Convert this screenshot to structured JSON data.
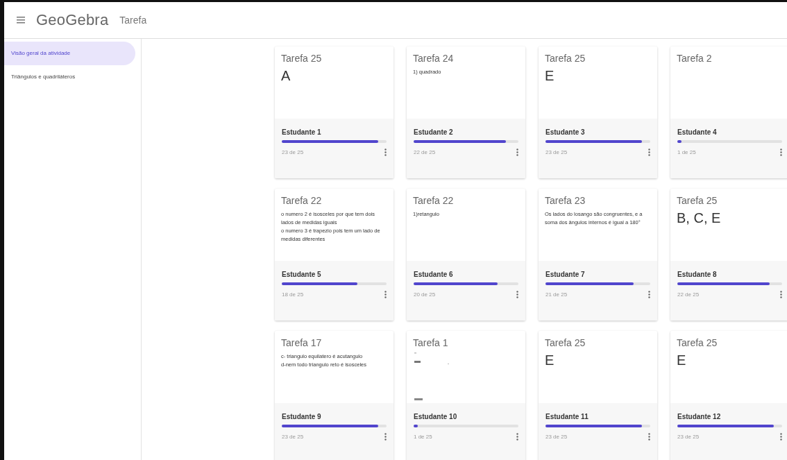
{
  "header": {
    "logo": "GeoGebra",
    "title": "Tarefa"
  },
  "sidebar": {
    "items": [
      {
        "label": "Visão geral da atividade",
        "selected": true
      },
      {
        "label": "Triângulos e quadriláteros",
        "selected": false
      }
    ]
  },
  "cards": [
    {
      "task": "Tarefa 25",
      "answer": {
        "kind": "letter",
        "lines": [
          "A"
        ]
      },
      "student": "Estudante 1",
      "level": 0.92,
      "progress": "23 de 25"
    },
    {
      "task": "Tarefa 24",
      "answer": {
        "kind": "text",
        "lines": [
          "1) quadrado"
        ]
      },
      "student": "Estudante 2",
      "level": 0.88,
      "progress": "22 de 25"
    },
    {
      "task": "Tarefa 25",
      "answer": {
        "kind": "letter",
        "lines": [
          "E"
        ]
      },
      "student": "Estudante 3",
      "level": 0.92,
      "progress": "23 de 25"
    },
    {
      "task": "Tarefa 2",
      "answer": {
        "kind": "none"
      },
      "student": "Estudante 4",
      "level": 0.04,
      "progress": "1 de 25"
    },
    {
      "task": "Tarefa 22",
      "answer": {
        "kind": "text",
        "lines": [
          "o numero 2 é isosceles por que tem dois lados de medidas iguais",
          "o numero 3 é trapezio pois tem um lado de medidas diferentes"
        ]
      },
      "student": "Estudante 5",
      "level": 0.72,
      "progress": "18 de 25"
    },
    {
      "task": "Tarefa 22",
      "answer": {
        "kind": "text",
        "lines": [
          "1)retangulo"
        ]
      },
      "student": "Estudante 6",
      "level": 0.8,
      "progress": "20 de 25"
    },
    {
      "task": "Tarefa 23",
      "answer": {
        "kind": "text",
        "lines": [
          "Os lados do losango são congruentes, e a soma dos ângulos internos é igual a 180°"
        ]
      },
      "student": "Estudante 7",
      "level": 0.84,
      "progress": "21 de 25"
    },
    {
      "task": "Tarefa 25",
      "answer": {
        "kind": "letter",
        "lines": [
          "B, C, E"
        ]
      },
      "student": "Estudante 8",
      "level": 0.88,
      "progress": "22 de 25"
    },
    {
      "task": "Tarefa 17",
      "answer": {
        "kind": "text",
        "lines": [
          "c- triangulo equilatero é acutangulo",
          "d-nem todo triangulo reto é isosceles"
        ]
      },
      "student": "Estudante 9",
      "level": 0.92,
      "progress": "23 de 25"
    },
    {
      "task": "Tarefa 1",
      "answer": {
        "kind": "sketch"
      },
      "student": "Estudante 10",
      "level": 0.04,
      "progress": "1 de 25"
    },
    {
      "task": "Tarefa 25",
      "answer": {
        "kind": "letter",
        "lines": [
          "E"
        ]
      },
      "student": "Estudante 11",
      "level": 0.92,
      "progress": "23 de 25"
    },
    {
      "task": "Tarefa 25",
      "answer": {
        "kind": "letter",
        "lines": [
          "E"
        ]
      },
      "student": "Estudante 12",
      "level": 0.92,
      "progress": "23 de 25"
    }
  ]
}
